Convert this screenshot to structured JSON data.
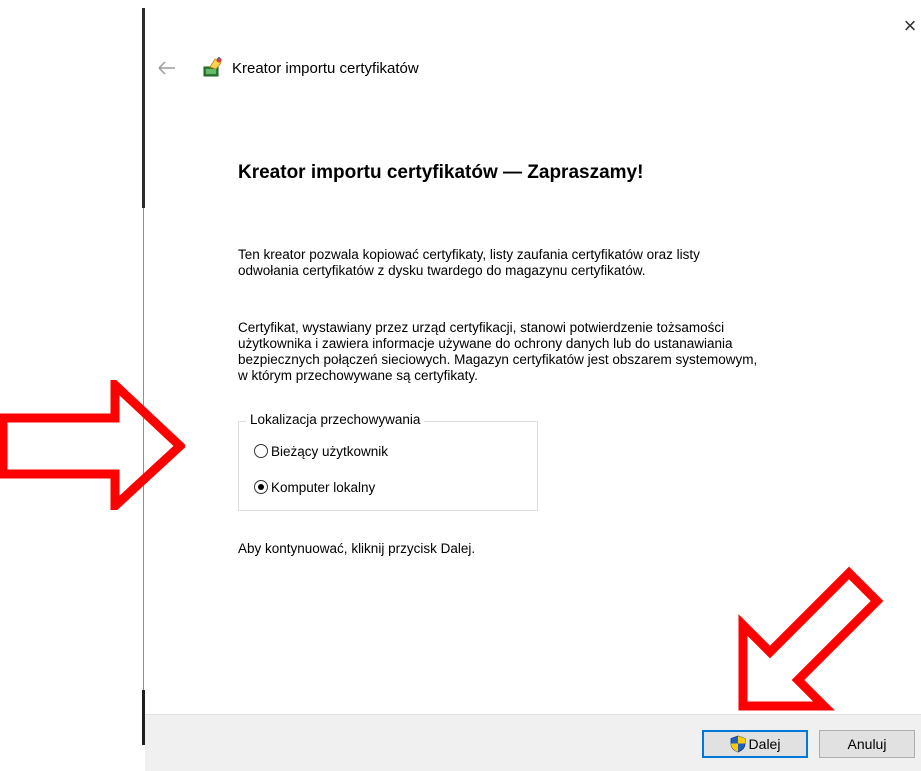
{
  "window": {
    "title": "Kreator importu certyfikatów",
    "close_icon": "close-icon",
    "back_icon": "back-arrow-icon",
    "wizard_icon": "certificate-wizard-icon"
  },
  "content": {
    "heading": "Kreator importu certyfikatów — Zapraszamy!",
    "paragraph1": [
      "Ten kreator pozwala kopiować certyfikaty, listy zaufania certyfikatów oraz listy",
      "odwołania certyfikatów z dysku twardego do magazynu certyfikatów."
    ],
    "paragraph2": [
      "Certyfikat, wystawiany przez urząd certyfikacji, stanowi potwierdzenie tożsamości",
      "użytkownika i zawiera informacje używane do ochrony danych lub do ustanawiania",
      "bezpiecznych połączeń sieciowych. Magazyn certyfikatów jest obszarem systemowym,",
      "w którym przechowywane są certyfikaty."
    ],
    "store_location": {
      "legend": "Lokalizacja przechowywania",
      "options": [
        {
          "label": "Bieżący użytkownik",
          "selected": false
        },
        {
          "label": "Komputer lokalny",
          "selected": true
        }
      ]
    },
    "continue_hint": "Aby kontynuować, kliknij przycisk Dalej."
  },
  "footer": {
    "next_label": "Dalej",
    "next_icon": "uac-shield-icon",
    "cancel_label": "Anuluj"
  },
  "colors": {
    "annotation_arrow": "#ff0000",
    "default_button_border": "#0078d7",
    "footer_background": "#f0f0f0"
  }
}
